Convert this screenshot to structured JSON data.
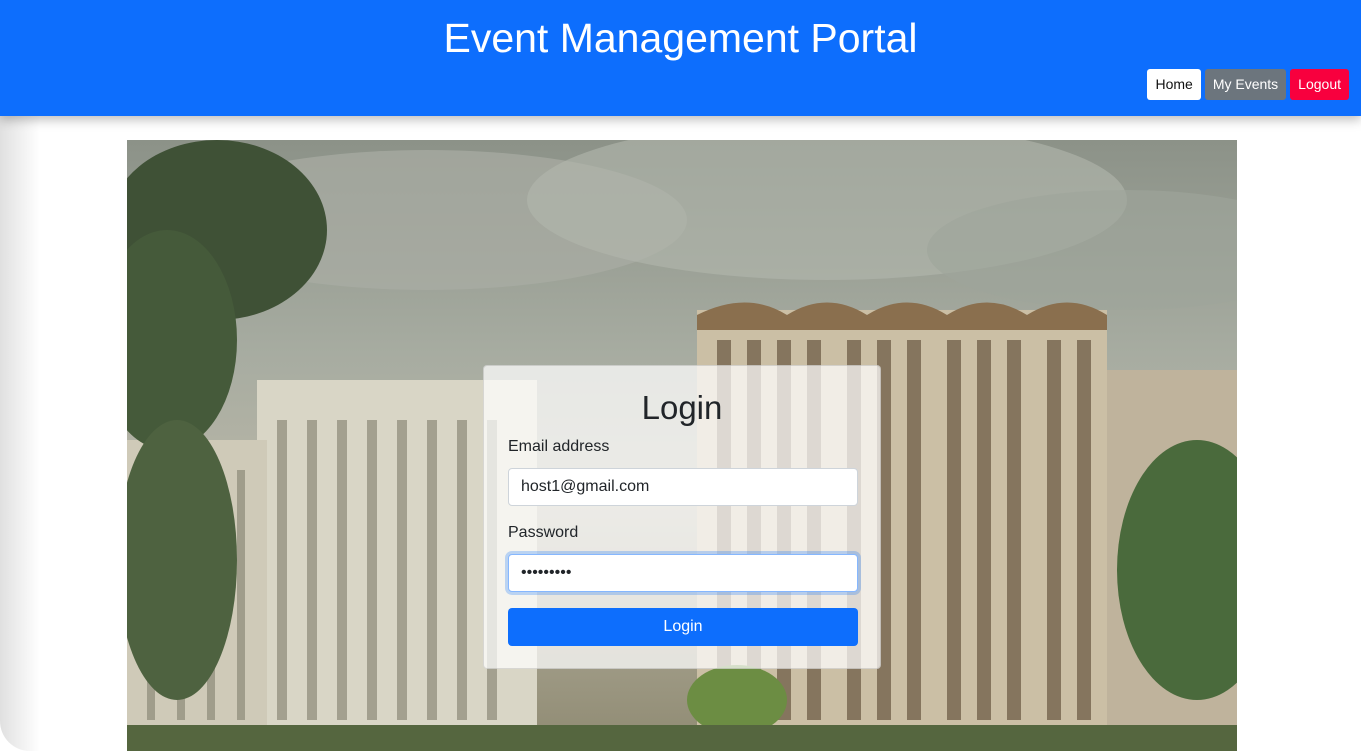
{
  "header": {
    "title": "Event Management Portal",
    "nav": {
      "home_label": "Home",
      "my_events_label": "My Events",
      "logout_label": "Logout"
    }
  },
  "login": {
    "title": "Login",
    "email_label": "Email address",
    "email_value": "host1@gmail.com",
    "password_label": "Password",
    "password_value": "•••••••••",
    "submit_label": "Login"
  },
  "colors": {
    "header_bg": "#0d6efd",
    "logout_bg": "#f8003e",
    "my_events_bg": "#6c757d",
    "primary_button": "#0d6efd"
  }
}
